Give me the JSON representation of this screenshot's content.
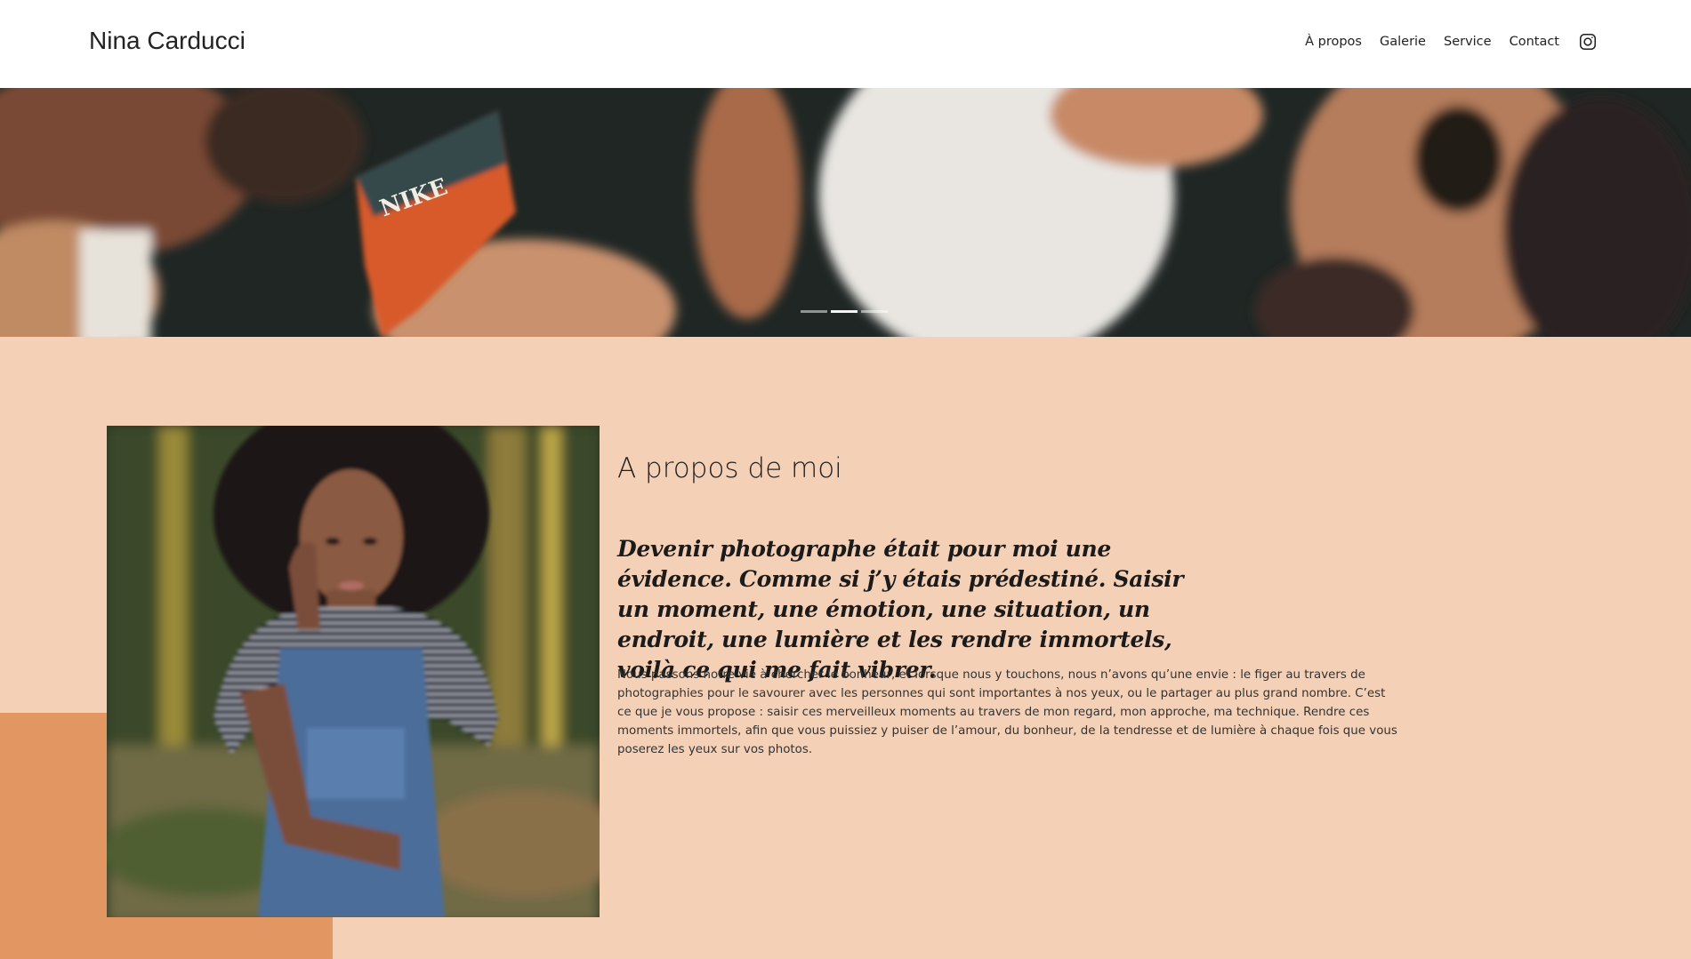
{
  "header": {
    "brand": "Nina Carducci",
    "nav": [
      {
        "label": "À propos"
      },
      {
        "label": "Galerie"
      },
      {
        "label": "Service"
      },
      {
        "label": "Contact"
      }
    ],
    "social_icon": "instagram-icon"
  },
  "hero": {
    "image_text": "NIKE",
    "slides_count": 3,
    "active_slide": 2
  },
  "about": {
    "title": "A propos de moi",
    "quote": "Devenir photographe était pour moi une évidence. Comme si j’y étais prédestiné. Saisir un moment, une émotion, une situation, un endroit, une lumière et les rendre immortels, voilà ce qui me fait vibrer.",
    "body": "Nous passons notre vie à chercher le bonheur, et lorsque nous y touchons, nous n’avons qu’une envie : le figer au travers de photographies pour le savourer avec les personnes qui sont importantes à nos yeux, ou le partager au plus grand nombre. C’est ce que je vous propose : saisir ces merveilleux moments au travers de mon regard, mon approche, ma technique. Rendre ces moments immortels, afin que vous puissiez y puiser de l’amour, du bonheur, de la tendresse et de lumière à chaque fois que vous poserez les yeux sur vos photos."
  },
  "colors": {
    "section_bg": "#f4d0b6",
    "accent": "#e29662",
    "header_bg": "#ffffff"
  }
}
